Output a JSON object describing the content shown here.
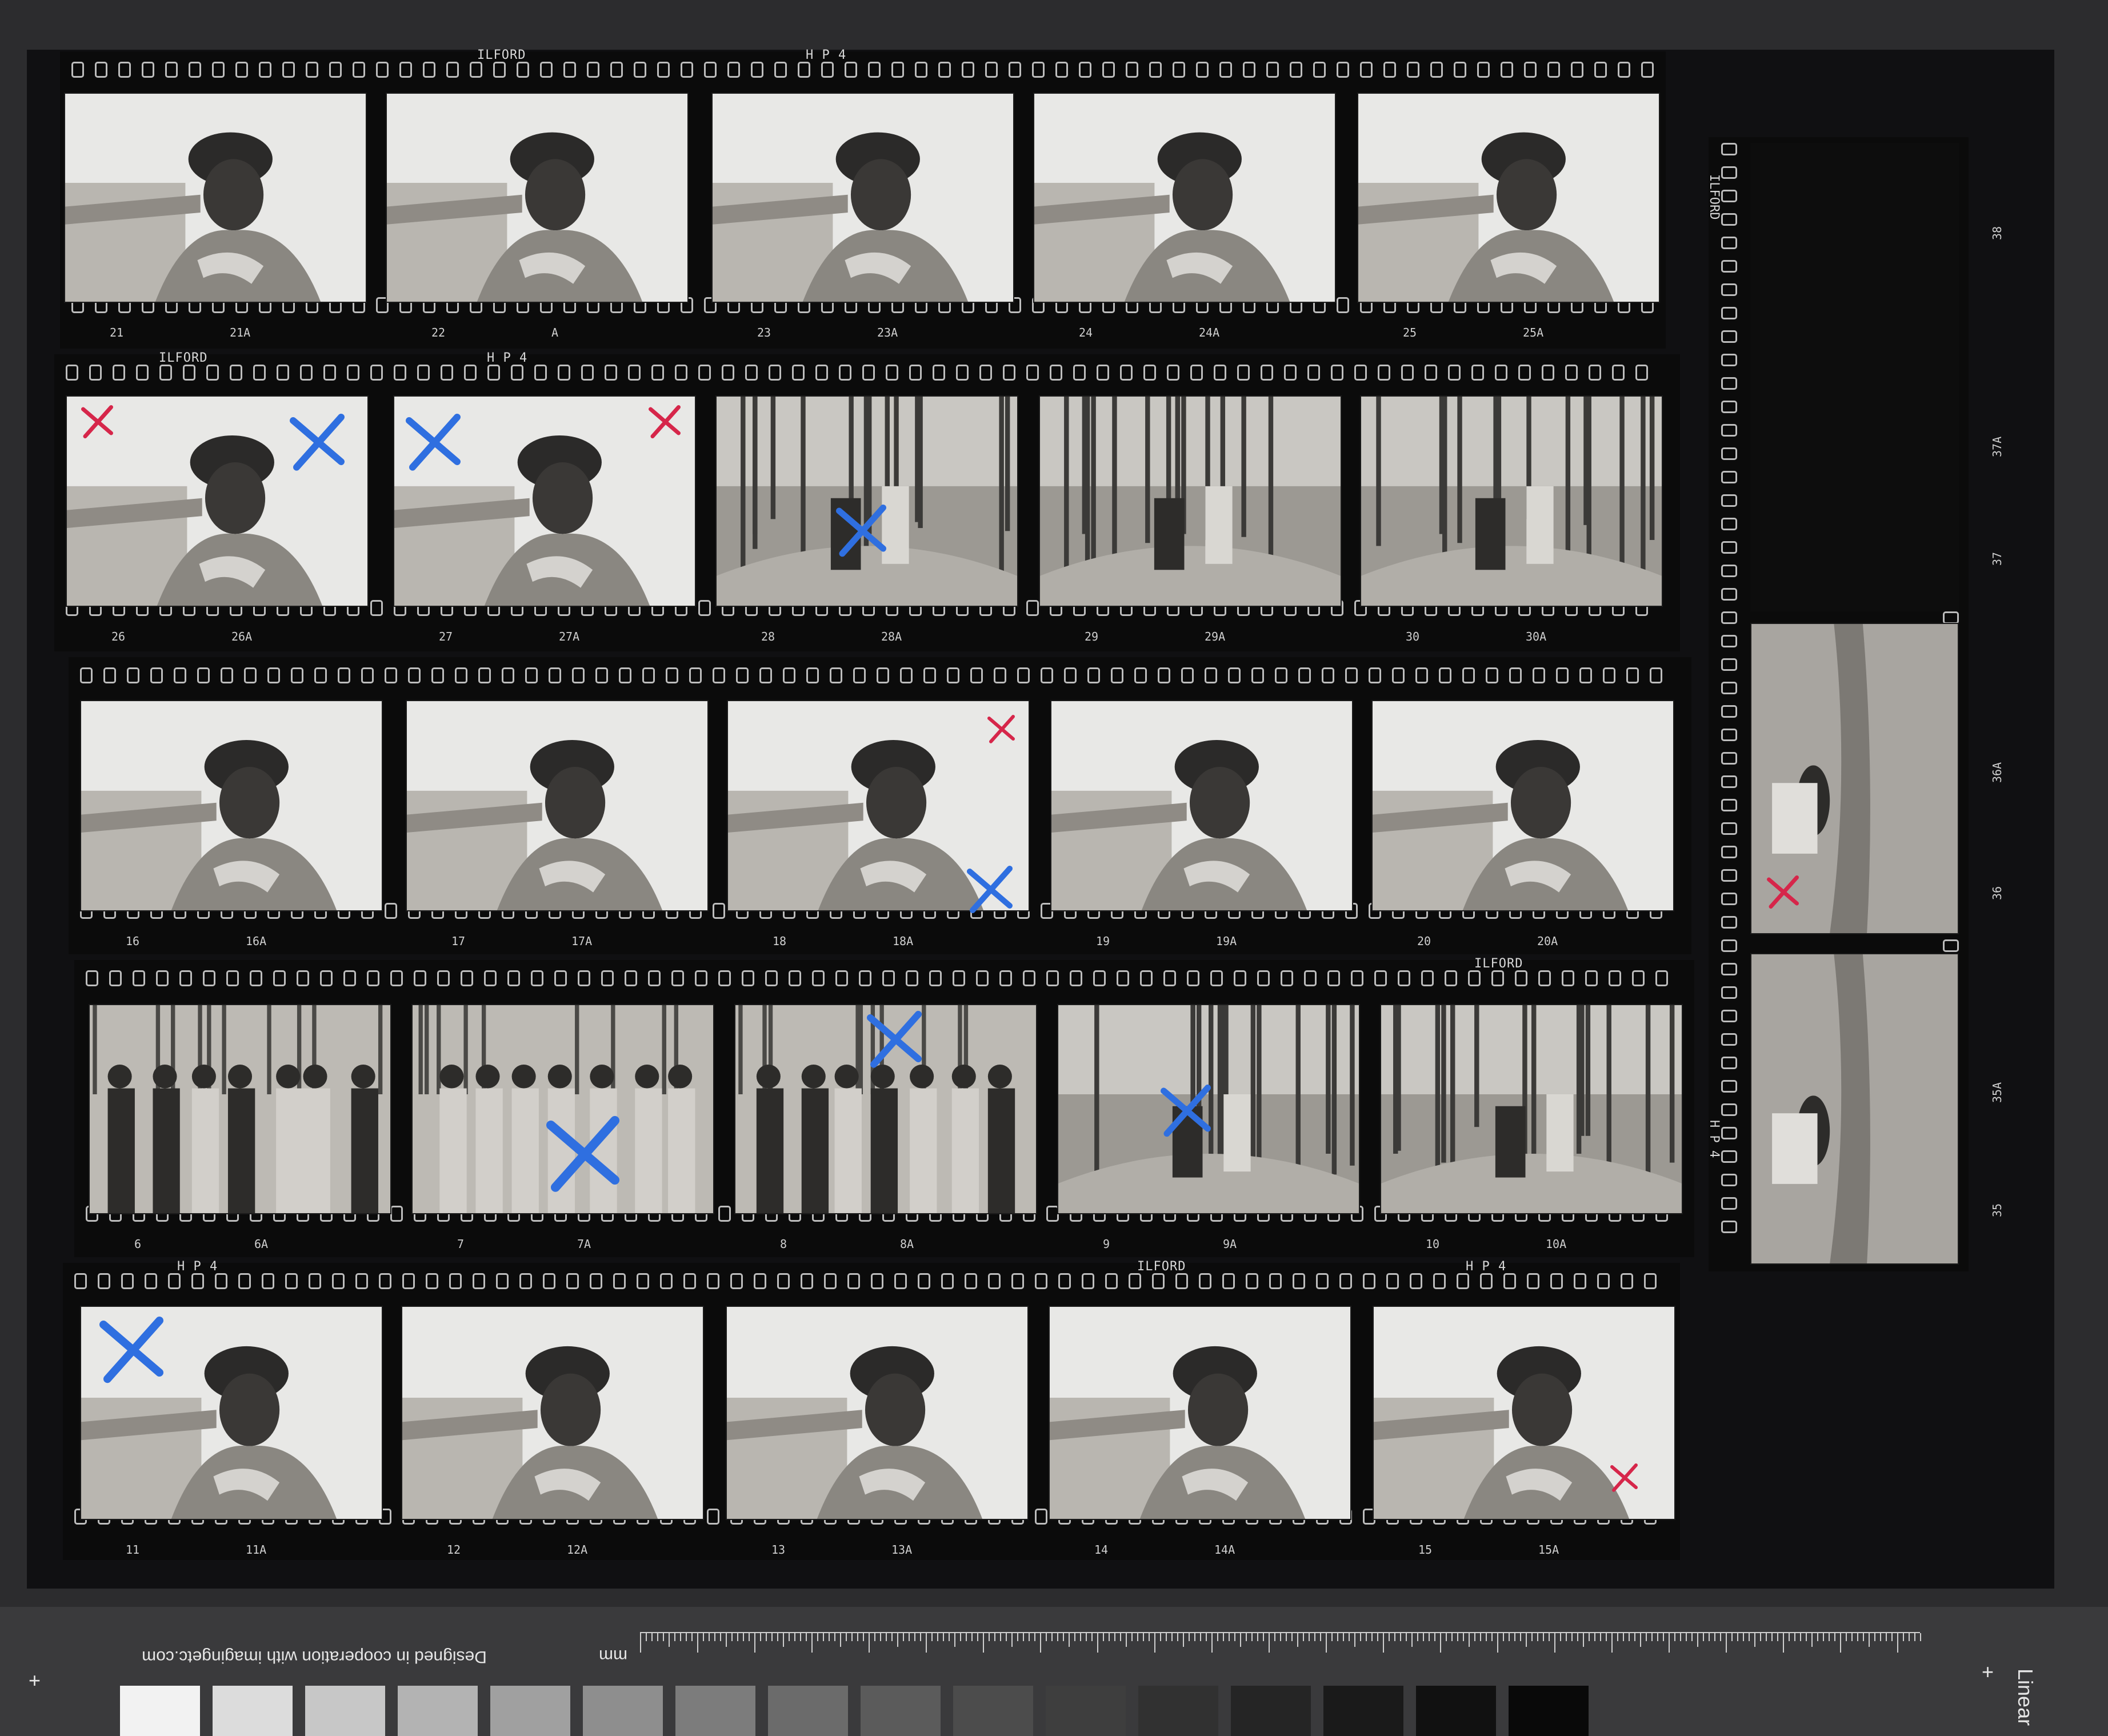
{
  "contact_sheet": {
    "edge_text": {
      "brand": "ILFORD",
      "film": "H P 4",
      "film_vertical_lower": "H P 4"
    },
    "rows": [
      {
        "labels": [
          "21",
          "21A",
          "22",
          "A",
          "23",
          "23A",
          "24",
          "24A",
          "25",
          "25A"
        ]
      },
      {
        "labels": [
          "26",
          "26A",
          "27",
          "27A",
          "28",
          "28A",
          "29",
          "29A",
          "30",
          "30A"
        ]
      },
      {
        "labels": [
          "16",
          "16A",
          "17",
          "17A",
          "18",
          "18A",
          "19",
          "19A",
          "20",
          "20A"
        ]
      },
      {
        "labels": [
          "6",
          "6A",
          "7",
          "7A",
          "8",
          "8A",
          "9",
          "9A",
          "10",
          "10A"
        ]
      },
      {
        "labels": [
          "11",
          "11A",
          "12",
          "12A",
          "13",
          "13A",
          "14",
          "14A",
          "15",
          "15A"
        ]
      }
    ],
    "vertical_strip": {
      "labels": [
        "38",
        "37A",
        "37",
        "36A",
        "36",
        "35A",
        "35"
      ]
    }
  },
  "scale_bar": {
    "credit": "Designed in cooperation with imagingetc.com",
    "unit": "mm",
    "mode": "Linear",
    "plus_left": "+",
    "plus_right": "+"
  },
  "colors": {
    "red_mark": "#d6264a",
    "blue_mark": "#2f6fe0",
    "film_base": "#0b0b0b",
    "swatches": [
      "#f2f2f2",
      "#dcdcdc",
      "#c7c7c7",
      "#b3b3b3",
      "#a0a0a0",
      "#8e8e8e",
      "#7c7c7c",
      "#6b6b6b",
      "#5b5b5b",
      "#4c4c4c",
      "#3e3e3e",
      "#313131",
      "#252525",
      "#1a1a1a",
      "#111111",
      "#090909"
    ]
  }
}
